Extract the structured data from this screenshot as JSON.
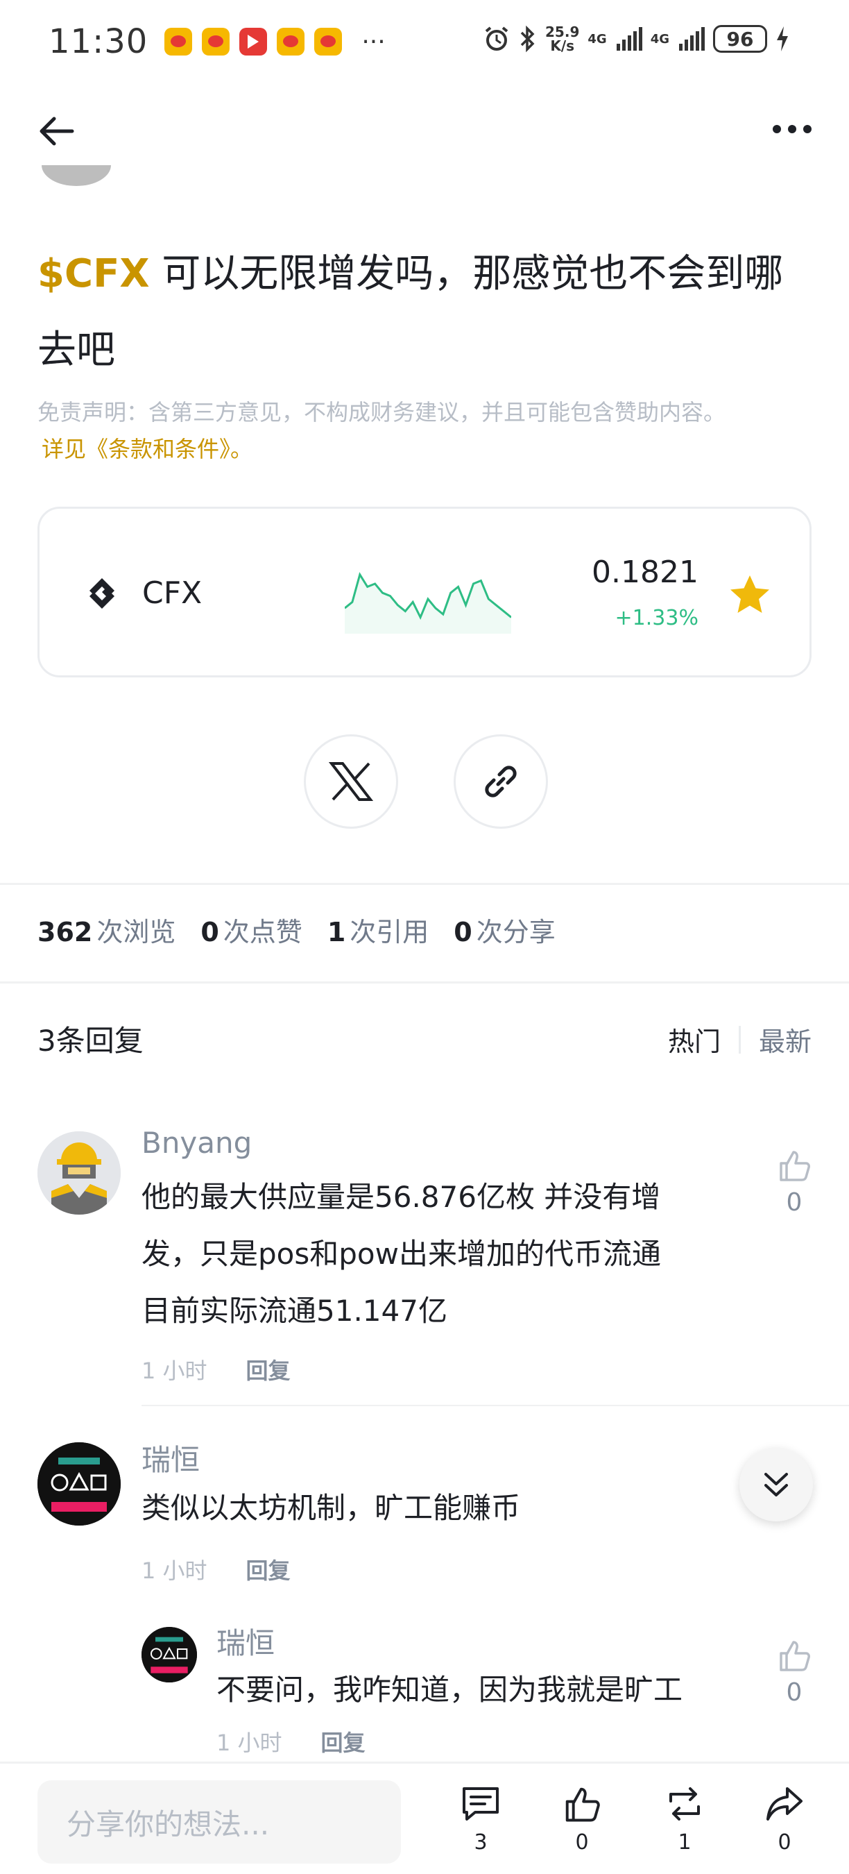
{
  "status_bar": {
    "time": "11:30",
    "overflow_dots": "···",
    "net_speed_value": "25.9",
    "net_speed_unit": "K/s",
    "signal1_label": "4G",
    "signal2_label": "4G",
    "battery": "96"
  },
  "post": {
    "cashtag": "$CFX",
    "title_rest": " 可以无限增发吗，那感觉也不会到哪去吧",
    "disclaimer": "免责声明：含第三方意见，不构成财务建议，并且可能包含赞助内容。",
    "terms_link": "详见《条款和条件》。"
  },
  "coin_card": {
    "symbol": "CFX",
    "price": "0.1821",
    "change": "+1.33%",
    "sparkline": [
      0.35,
      0.45,
      0.9,
      0.7,
      0.75,
      0.6,
      0.55,
      0.4,
      0.3,
      0.45,
      0.2,
      0.5,
      0.35,
      0.25,
      0.6,
      0.7,
      0.4,
      0.75,
      0.8,
      0.5,
      0.4,
      0.3,
      0.2
    ],
    "up_color": "#2ebd85",
    "star_color": "#f0b90b"
  },
  "stats": [
    {
      "num": "362",
      "label": "次浏览"
    },
    {
      "num": "0",
      "label": "次点赞"
    },
    {
      "num": "1",
      "label": "次引用"
    },
    {
      "num": "0",
      "label": "次分享"
    }
  ],
  "replies": {
    "title": "3条回复",
    "sort_hot": "热门",
    "sort_new": "最新"
  },
  "comments": [
    {
      "name": "Bnyang",
      "lines": [
        "他的最大供应量是56.876亿枚 并没有增",
        "发，只是pos和pow出来增加的代币流通",
        "目前实际流通51.147亿"
      ],
      "time": "1 小时",
      "reply": "回复",
      "likes": "0"
    },
    {
      "name": "瑞恒",
      "lines": [
        "类似以太坊机制，旷工能赚币"
      ],
      "time": "1 小时",
      "reply": "回复",
      "likes": ""
    },
    {
      "name": "瑞恒",
      "lines": [
        "不要问，我咋知道，因为我就是旷工"
      ],
      "time": "1 小时",
      "reply": "回复",
      "likes": "0"
    }
  ],
  "bottom_bar": {
    "input_placeholder": "分享你的想法...",
    "comments_count": "3",
    "likes_count": "0",
    "reposts_count": "1",
    "shares_count": "0"
  },
  "accent_color": "#c99400"
}
